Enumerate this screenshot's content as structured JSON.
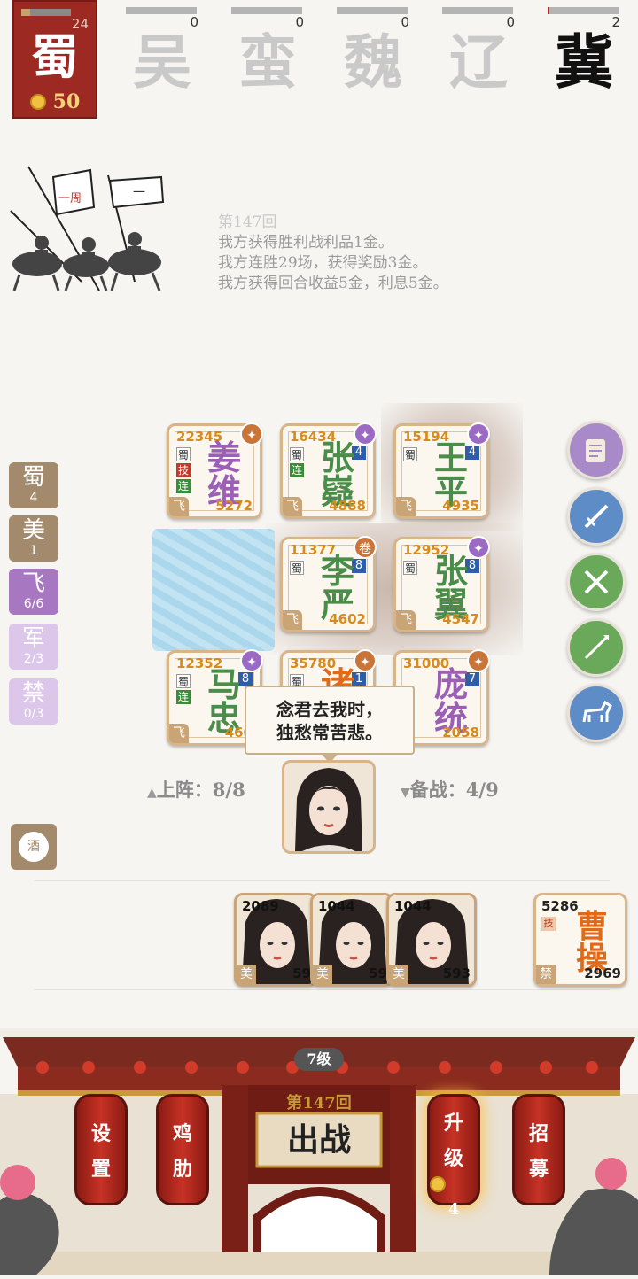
{
  "factions": {
    "main": {
      "name": "蜀",
      "count": "24",
      "gold": "50"
    },
    "others": [
      {
        "name": "吴",
        "count": "0",
        "progress": 0
      },
      {
        "name": "蛮",
        "count": "0",
        "progress": 0
      },
      {
        "name": "魏",
        "count": "0",
        "progress": 0
      },
      {
        "name": "辽",
        "count": "0",
        "progress": 0
      },
      {
        "name": "冀",
        "count": "2",
        "progress": 0.03
      }
    ]
  },
  "log": {
    "round": "第147回",
    "lines": [
      "我方获得胜利战利品1金。",
      "我方连胜29场，获得奖励3金。",
      "我方获得回合收益5金，利息5金。"
    ]
  },
  "banner_text": {
    "a": "一周",
    "b": "一"
  },
  "board": {
    "cards": [
      {
        "n1": "姜",
        "n2": "维",
        "atk": "22345",
        "hp": "5272",
        "tags": [
          "蜀",
          "技",
          "连"
        ],
        "lvl": "",
        "color": "purple",
        "badge": "✦"
      },
      {
        "n1": "张",
        "n2": "嶷",
        "atk": "16434",
        "hp": "4888",
        "tags": [
          "蜀",
          "连"
        ],
        "lvl": "4",
        "color": "green",
        "badge": "✦"
      },
      {
        "n1": "王",
        "n2": "平",
        "atk": "15194",
        "hp": "4935",
        "tags": [
          "蜀"
        ],
        "lvl": "4",
        "color": "green",
        "badge": "✦"
      },
      {
        "n1": "李",
        "n2": "严",
        "atk": "11377",
        "hp": "4602",
        "tags": [
          "蜀"
        ],
        "lvl": "8",
        "color": "green",
        "badge": "卷"
      },
      {
        "n1": "张",
        "n2": "翼",
        "atk": "12952",
        "hp": "4547",
        "tags": [
          "蜀"
        ],
        "lvl": "8",
        "color": "green",
        "badge": "✦"
      },
      {
        "n1": "马",
        "n2": "忠",
        "atk": "12352",
        "hp": "460",
        "tags": [
          "蜀",
          "连"
        ],
        "lvl": "8",
        "color": "green",
        "badge": "✦"
      },
      {
        "n1": "诸",
        "n2": "",
        "atk": "35780",
        "hp": "",
        "tags": [
          "蜀"
        ],
        "lvl": "1",
        "color": "orange",
        "badge": "✦"
      },
      {
        "n1": "庞",
        "n2": "统",
        "atk": "31000",
        "hp": "2058",
        "tags": [],
        "lvl": "7",
        "color": "purple",
        "badge": "✦"
      }
    ],
    "fei": "飞"
  },
  "tabs": [
    {
      "label": "蜀",
      "count": "4"
    },
    {
      "label": "美",
      "count": "1"
    },
    {
      "label": "飞",
      "count": "6/6"
    },
    {
      "label": "军",
      "count": "2/3"
    },
    {
      "label": "禁",
      "count": "0/3"
    }
  ],
  "skills": [
    "scroll-icon",
    "sword-icon",
    "crossed-swords-icon",
    "spear-icon",
    "horse-icon"
  ],
  "speech": {
    "line1": "念君去我时，",
    "line2": "独愁常苦悲。"
  },
  "status": {
    "deployed": "上阵：8/8",
    "reserve": "备战：4/9"
  },
  "wine_label": "酒",
  "bench": [
    {
      "atk": "2089",
      "hp": "59",
      "tag": "美"
    },
    {
      "atk": "1044",
      "hp": "59",
      "tag": "美"
    },
    {
      "atk": "1044",
      "hp": "593",
      "tag": "美"
    }
  ],
  "caocao": {
    "n1": "曹",
    "n2": "操",
    "atk": "5286",
    "hp": "2969",
    "tag": "禁",
    "skill": "技"
  },
  "bottom": {
    "level": "7级",
    "round": "第147回",
    "battle": "出战",
    "settings": [
      "设",
      "置"
    ],
    "chicken": [
      "鸡",
      "肋"
    ],
    "upgrade": [
      "升",
      "级"
    ],
    "upgrade_cost": "4",
    "recruit": [
      "招",
      "募"
    ]
  }
}
